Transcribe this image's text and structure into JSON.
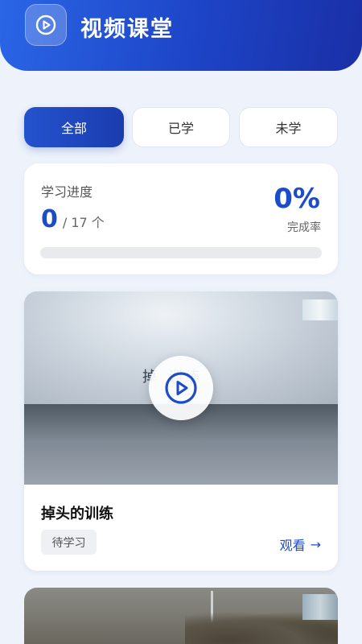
{
  "header": {
    "title": "视频课堂",
    "icon": "play-circle-icon"
  },
  "tabs": [
    {
      "label": "全部",
      "active": true
    },
    {
      "label": "已学",
      "active": false
    },
    {
      "label": "未学",
      "active": false
    }
  ],
  "progress": {
    "label": "学习进度",
    "completed": "0",
    "total_text": "/ 17 个",
    "percent_text": "0%",
    "rate_label": "完成率",
    "fraction": 0
  },
  "videos": [
    {
      "thumbnail_text": "掉 训练",
      "title": "掉头的训练",
      "status": "待学习",
      "action_label": "观看",
      "action_icon": "arrow-right-icon"
    }
  ],
  "colors": {
    "accent": "#1d4cc8",
    "header_gradient_start": "#2a66e6",
    "header_gradient_end": "#1a2fa6",
    "background": "#eef3fb"
  }
}
